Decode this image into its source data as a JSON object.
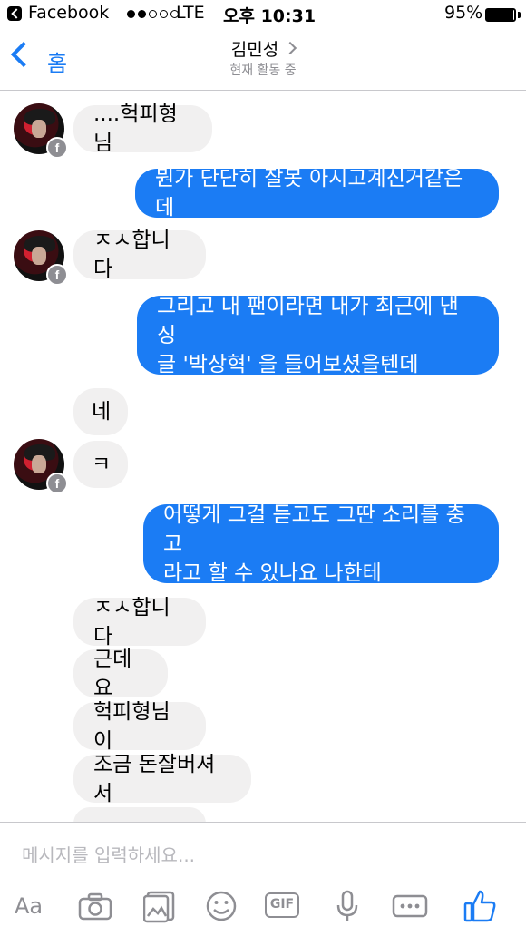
{
  "status_bar": {
    "app": "Facebook",
    "network": "LTE",
    "time": "오후 10:31",
    "battery": "95%",
    "battery_level": 0.95
  },
  "header": {
    "back_label": "홈",
    "title": "김민성",
    "subtitle": "현재 활동 중"
  },
  "messages": [
    {
      "text": "....헉피형님"
    },
    {
      "text": "뭔가 단단히 잘못 아시고계신거같은데"
    },
    {
      "text": "ㅈㅅ합니다"
    },
    {
      "line1": "그리고 내 팬이라면 내가 최근에 낸 싱",
      "line2": "글 '박상혁' 을 들어보셨을텐데"
    },
    {
      "text": "네"
    },
    {
      "text": "ㅋ"
    },
    {
      "line1": "어떻게 그걸 듣고도 그딴 소리를 충고",
      "line2": "라고 할 수 있나요 나한테"
    },
    {
      "text": "ㅈㅅ합니다"
    },
    {
      "text": "근데요"
    },
    {
      "text": "헉피형님이"
    },
    {
      "text": "조금 돈잘버셔서"
    }
  ],
  "composer": {
    "placeholder": "메시지를 입력하세요...",
    "aa_label": "Aa",
    "gif_label": "GIF"
  },
  "colors": {
    "accent": "#1b7cf4",
    "incoming": "#f1f0f0",
    "icon_gray": "#8e8e93"
  }
}
